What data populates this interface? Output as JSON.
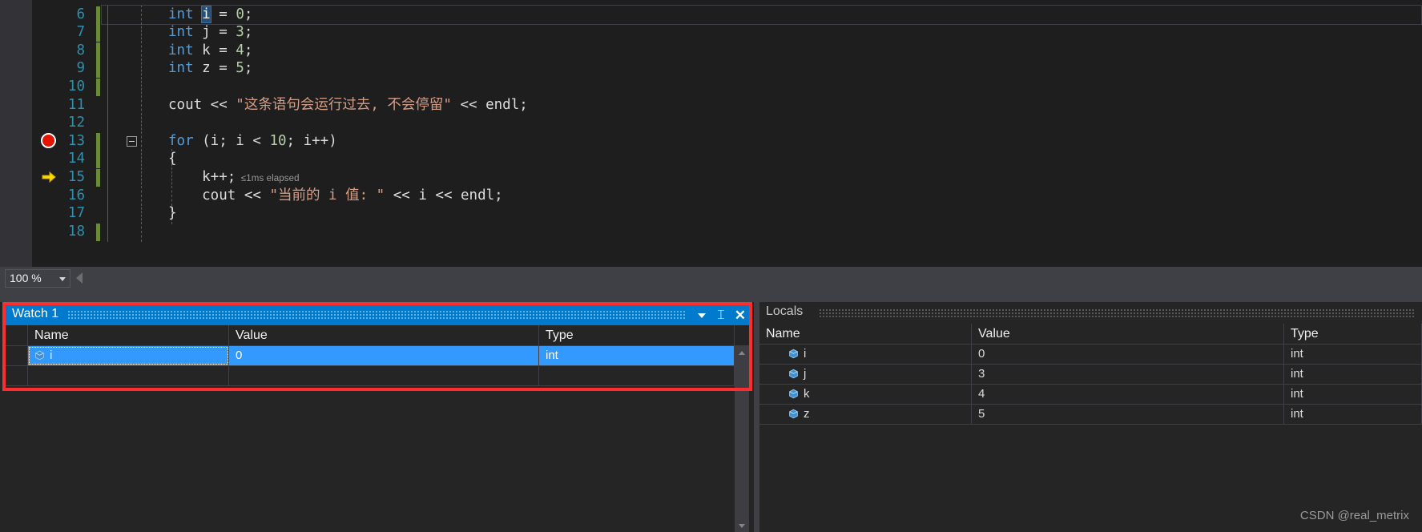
{
  "editor": {
    "language": "cpp",
    "lines": [
      {
        "number": "",
        "partial": "{",
        "changed": false
      },
      {
        "number": "6",
        "changed": true,
        "current": true,
        "tokens": [
          {
            "t": "int",
            "c": "kw"
          },
          {
            "t": " ",
            "c": "plain"
          },
          {
            "t": "i",
            "c": "sel"
          },
          {
            "t": " = ",
            "c": "plain"
          },
          {
            "t": "0",
            "c": "num"
          },
          {
            "t": ";",
            "c": "plain"
          }
        ]
      },
      {
        "number": "7",
        "changed": true,
        "tokens": [
          {
            "t": "int",
            "c": "kw"
          },
          {
            "t": " j = ",
            "c": "plain"
          },
          {
            "t": "3",
            "c": "num"
          },
          {
            "t": ";",
            "c": "plain"
          }
        ]
      },
      {
        "number": "8",
        "changed": true,
        "tokens": [
          {
            "t": "int",
            "c": "kw"
          },
          {
            "t": " k = ",
            "c": "plain"
          },
          {
            "t": "4",
            "c": "num"
          },
          {
            "t": ";",
            "c": "plain"
          }
        ]
      },
      {
        "number": "9",
        "changed": true,
        "tokens": [
          {
            "t": "int",
            "c": "kw"
          },
          {
            "t": " z = ",
            "c": "plain"
          },
          {
            "t": "5",
            "c": "num"
          },
          {
            "t": ";",
            "c": "plain"
          }
        ]
      },
      {
        "number": "10",
        "changed": true,
        "tokens": []
      },
      {
        "number": "11",
        "changed": false,
        "tokens": [
          {
            "t": "cout << ",
            "c": "plain"
          },
          {
            "t": "\"这条语句会运行过去, 不会停留\"",
            "c": "str"
          },
          {
            "t": " << endl;",
            "c": "plain"
          }
        ]
      },
      {
        "number": "12",
        "changed": false,
        "tokens": []
      },
      {
        "number": "13",
        "changed": true,
        "breakpoint": true,
        "fold": true,
        "tokens": [
          {
            "t": "for",
            "c": "kw"
          },
          {
            "t": " (i; i < ",
            "c": "plain"
          },
          {
            "t": "10",
            "c": "num"
          },
          {
            "t": "; i++)",
            "c": "plain"
          }
        ]
      },
      {
        "number": "14",
        "changed": true,
        "tokens": [
          {
            "t": "{",
            "c": "plain"
          }
        ]
      },
      {
        "number": "15",
        "changed": true,
        "currentstmt": true,
        "tokens": [
          {
            "t": "    k++;",
            "c": "plain"
          }
        ],
        "hint": "≤1ms elapsed"
      },
      {
        "number": "16",
        "changed": false,
        "tokens": [
          {
            "t": "    cout << ",
            "c": "plain"
          },
          {
            "t": "\"当前的 i 值: \"",
            "c": "str"
          },
          {
            "t": " << i << endl;",
            "c": "plain"
          }
        ]
      },
      {
        "number": "17",
        "changed": false,
        "tokens": [
          {
            "t": "}",
            "c": "plain"
          }
        ]
      },
      {
        "number": "18",
        "changed": true,
        "tokens": []
      }
    ]
  },
  "zoombar": {
    "zoom_level": "100 %",
    "caret_icon": "chevron-down-icon",
    "split_icon": "horizontal-split-icon"
  },
  "watch": {
    "title": "Watch 1",
    "title_buttons": [
      {
        "name": "window-menu-dropdown",
        "icon": "chevron-down-icon",
        "glyph": ""
      },
      {
        "name": "auto-hide-pin",
        "icon": "pin-icon",
        "glyph": "⌶"
      },
      {
        "name": "close-window",
        "icon": "close-icon",
        "glyph": "✕"
      }
    ],
    "columns": [
      "Name",
      "Value",
      "Type"
    ],
    "rows": [
      {
        "name": "i",
        "value": "0",
        "type": "int",
        "selected": true,
        "icon": "cube-icon"
      },
      {
        "name": "",
        "value": "",
        "type": "",
        "selected": false,
        "icon": ""
      }
    ],
    "scrollbar": {
      "up_icon": "scroll-up-arrow-icon",
      "down_icon": "scroll-down-arrow-icon"
    }
  },
  "locals": {
    "title": "Locals",
    "columns": [
      "Name",
      "Value",
      "Type"
    ],
    "rows": [
      {
        "name": "i",
        "value": "0",
        "type": "int",
        "icon": "cube-icon"
      },
      {
        "name": "j",
        "value": "3",
        "type": "int",
        "icon": "cube-icon"
      },
      {
        "name": "k",
        "value": "4",
        "type": "int",
        "icon": "cube-icon"
      },
      {
        "name": "z",
        "value": "5",
        "type": "int",
        "icon": "cube-icon"
      }
    ]
  },
  "watermark": "CSDN @real_metrix",
  "colors": {
    "accent_blue": "#007acc",
    "selection_blue": "#3399ff",
    "highlight_red": "#ff2d2d",
    "breakpoint_red": "#e51400",
    "current_arrow_yellow": "#ffd600",
    "editor_bg": "#1e1e1e",
    "panel_bg": "#252526",
    "chrome_bg": "#3f3f46"
  }
}
